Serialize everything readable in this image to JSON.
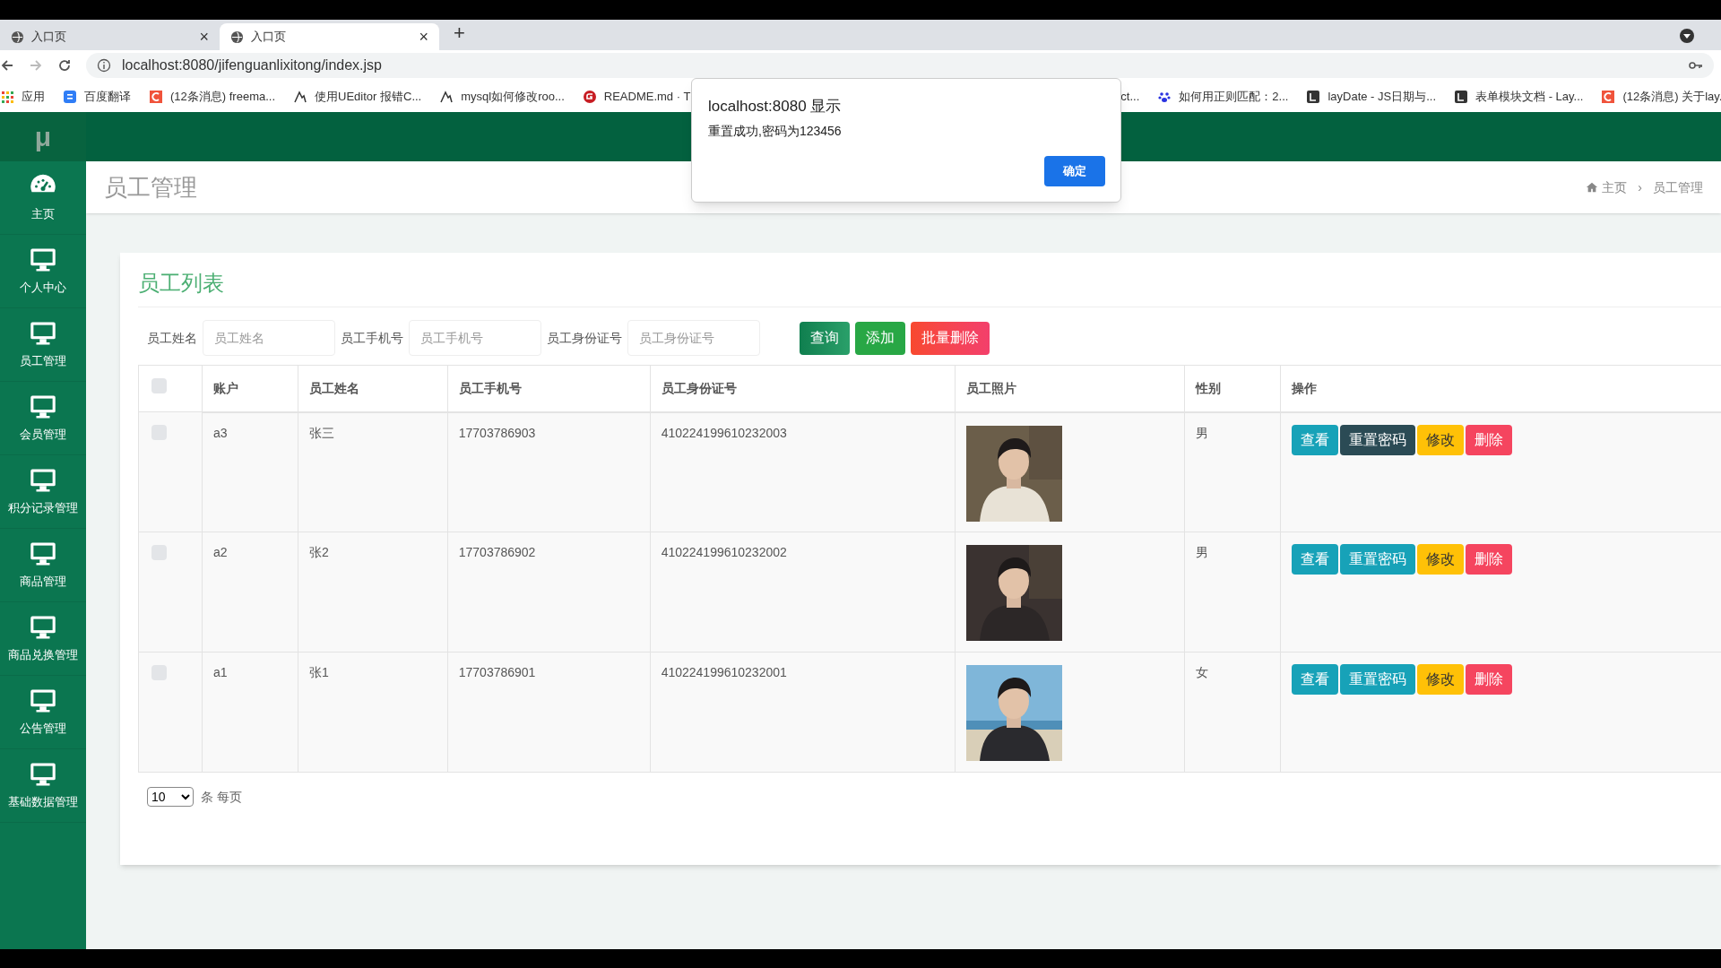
{
  "browser": {
    "tabs": [
      {
        "label": "入口页",
        "close": "×",
        "selected": false
      },
      {
        "label": "入口页",
        "close": "×",
        "selected": true
      }
    ],
    "new_tab": "+",
    "url": "localhost:8080/jifenguanlixitong/index.jsp",
    "bookmarks": [
      {
        "label": "应用",
        "kind": "apps"
      },
      {
        "label": "百度翻译",
        "kind": "translate"
      },
      {
        "label": "(12条消息) freema...",
        "kind": "csdn"
      },
      {
        "label": "使用UEditor 报错C...",
        "kind": "link"
      },
      {
        "label": "mysql如何修改roo...",
        "kind": "link"
      },
      {
        "label": "README.md · T",
        "kind": "gitee"
      },
      {
        "label": "ct...",
        "kind": "none"
      },
      {
        "label": "如何用正则匹配：2...",
        "kind": "paw"
      },
      {
        "label": "layDate - JS日期与...",
        "kind": "layui"
      },
      {
        "label": "表单模块文档 - Lay...",
        "kind": "layui"
      },
      {
        "label": "(12条消息) 关于lay.",
        "kind": "csdn"
      }
    ]
  },
  "dialog": {
    "title": "localhost:8080 显示",
    "message": "重置成功,密码为123456",
    "button": "确定"
  },
  "logo": "μ",
  "sidebar": {
    "items": [
      {
        "label": "主页",
        "kind": "dashboard"
      },
      {
        "label": "个人中心",
        "kind": "monitor"
      },
      {
        "label": "员工管理",
        "kind": "monitor"
      },
      {
        "label": "会员管理",
        "kind": "monitor"
      },
      {
        "label": "积分记录管理",
        "kind": "monitor"
      },
      {
        "label": "商品管理",
        "kind": "monitor"
      },
      {
        "label": "商品兑换管理",
        "kind": "monitor"
      },
      {
        "label": "公告管理",
        "kind": "monitor"
      },
      {
        "label": "基础数据管理",
        "kind": "monitor"
      }
    ]
  },
  "page_title": "员工管理",
  "breadcrumb": [
    "主页",
    "›",
    "员工管理"
  ],
  "card_title": "员工列表",
  "filters": [
    {
      "label": "员工姓名",
      "placeholder": "员工姓名"
    },
    {
      "label": "员工手机号",
      "placeholder": "员工手机号"
    },
    {
      "label": "员工身份证号",
      "placeholder": "员工身份证号"
    }
  ],
  "toolbar": [
    {
      "label": "查询",
      "kind": "search"
    },
    {
      "label": "添加",
      "kind": "add"
    },
    {
      "label": "批量删除",
      "kind": "delete"
    }
  ],
  "table": {
    "header_checked": false,
    "columns": [
      "账户",
      "员工姓名",
      "员工手机号",
      "员工身份证号",
      "员工照片",
      "性别",
      "操作"
    ],
    "rows": [
      {
        "checked": false,
        "account": "a3",
        "name": "张三",
        "phone": "17703786903",
        "id_number": "410224199610232003",
        "gender": "男",
        "actions": [
          {
            "label": "查看",
            "kind": "view",
            "focused": false
          },
          {
            "label": "重置密码",
            "kind": "reset",
            "focused": true
          },
          {
            "label": "修改",
            "kind": "edit",
            "focused": false
          },
          {
            "label": "删除",
            "kind": "delete",
            "focused": false
          }
        ]
      },
      {
        "checked": false,
        "account": "a2",
        "name": "张2",
        "phone": "17703786902",
        "id_number": "410224199610232002",
        "gender": "男",
        "actions": [
          {
            "label": "查看",
            "kind": "view",
            "focused": false
          },
          {
            "label": "重置密码",
            "kind": "reset",
            "focused": false
          },
          {
            "label": "修改",
            "kind": "edit",
            "focused": false
          },
          {
            "label": "删除",
            "kind": "delete",
            "focused": false
          }
        ]
      },
      {
        "checked": false,
        "account": "a1",
        "name": "张1",
        "phone": "17703786901",
        "id_number": "410224199610232001",
        "gender": "女",
        "actions": [
          {
            "label": "查看",
            "kind": "view",
            "focused": false
          },
          {
            "label": "重置密码",
            "kind": "reset",
            "focused": false
          },
          {
            "label": "修改",
            "kind": "edit",
            "focused": false
          },
          {
            "label": "删除",
            "kind": "delete",
            "focused": false
          }
        ]
      }
    ]
  },
  "pager": {
    "page_size": "10",
    "suffix": "条 每页"
  }
}
